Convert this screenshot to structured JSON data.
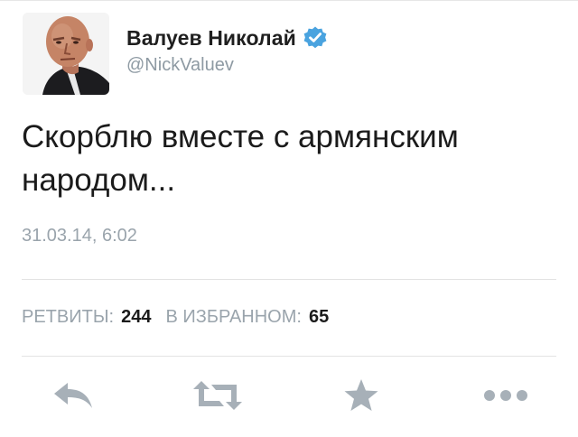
{
  "author": {
    "display_name": "Валуев Николай",
    "handle": "@NickValuev",
    "verified": true
  },
  "tweet": {
    "text": "Скорблю вместе с армянским\nнародом...",
    "timestamp": "31.03.14, 6:02"
  },
  "stats": {
    "retweets_label": "РЕТВИТЫ:",
    "retweets_count": "244",
    "favorites_label": "В ИЗБРАННОМ:",
    "favorites_count": "65"
  },
  "actions": [
    {
      "icon": "reply-icon"
    },
    {
      "icon": "retweet-icon"
    },
    {
      "icon": "star-icon"
    },
    {
      "icon": "more-icon"
    }
  ],
  "colors": {
    "text_primary": "#1b1b1b",
    "text_secondary": "#9aa4ac",
    "icon_gray": "#a7b0b8",
    "verified_blue": "#4aa3df",
    "divider": "#e3e3e3"
  }
}
